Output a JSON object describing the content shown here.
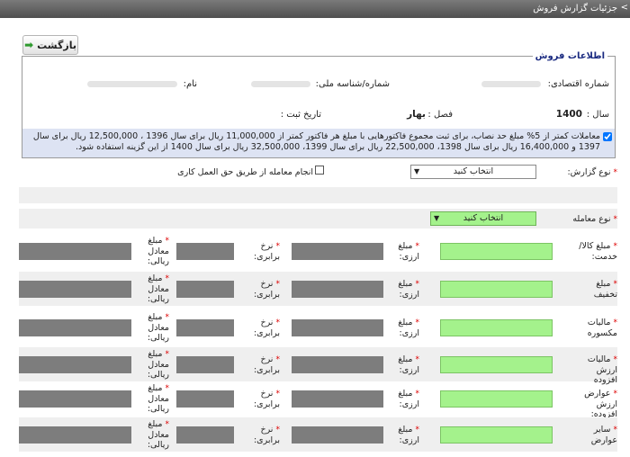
{
  "title_bar": {
    "title": "جزئیات گزارش فروش",
    "arrow": ">"
  },
  "back_button": {
    "label": "بازگشت",
    "icon": "arrow-right-icon"
  },
  "info": {
    "legend": "اطلاعات فروش",
    "economic_code_label": "شماره اقتصادی:",
    "national_id_label": "شماره/شناسه ملی:",
    "name_label": "نام:",
    "year_label": "سال :",
    "year_value": "1400",
    "season_label": "فصل :",
    "season_value": "بهار",
    "reg_date_label": "تاریخ ثبت :",
    "notice": "معاملات کمتر از 5% مبلغ حد نصاب، برای ثبت مجموع فاکتورهایی با مبلغ هر فاکتور کمتر از 11,000,000 ریال برای سال 1396 ، 12,500,000 ریال برای سال 1397 و 16,400,000 ریال برای سال 1398، 22,500,000 ریال برای سال 1399، 32,500,000 ریال برای سال 1400 از این گزینه استفاده شود."
  },
  "report_type": {
    "label": "نوع گزارش:",
    "value": "انتخاب کنید",
    "checkbox_label": "انجام معامله از طریق حق العمل کاری"
  },
  "transaction_type": {
    "label": "نوع معامله",
    "value": "انتخاب کنید"
  },
  "rows": [
    {
      "label": "مبلغ کالا/خدمت:",
      "currency_label": "مبلغ ارزی:",
      "rate_label": "نرخ برابری:",
      "rial_label": "مبلغ معادل ریالی:"
    },
    {
      "label": "مبلغ تخفیف",
      "currency_label": "مبلغ ارزی:",
      "rate_label": "نرخ برابری:",
      "rial_label": "مبلغ معادل ریالی:"
    },
    {
      "label": "مالیات مکسوره",
      "currency_label": "مبلغ ارزی:",
      "rate_label": "نرخ برابری:",
      "rial_label": "مبلغ معادل ریالی:"
    },
    {
      "label": "مالیات ارزش افزوده",
      "currency_label": "مبلغ ارزی:",
      "rate_label": "نرخ برابری:",
      "rial_label": "مبلغ معادل ریالی:"
    },
    {
      "label": "عوارض ارزش افزوده:",
      "currency_label": "مبلغ ارزی:",
      "rate_label": "نرخ برابری:",
      "rial_label": "مبلغ معادل ریالی:"
    },
    {
      "label": "سایر عوارض",
      "currency_label": "مبلغ ارزی:",
      "rate_label": "نرخ برابری:",
      "rial_label": "مبلغ معادل ریالی:"
    }
  ],
  "required_mark": "*"
}
